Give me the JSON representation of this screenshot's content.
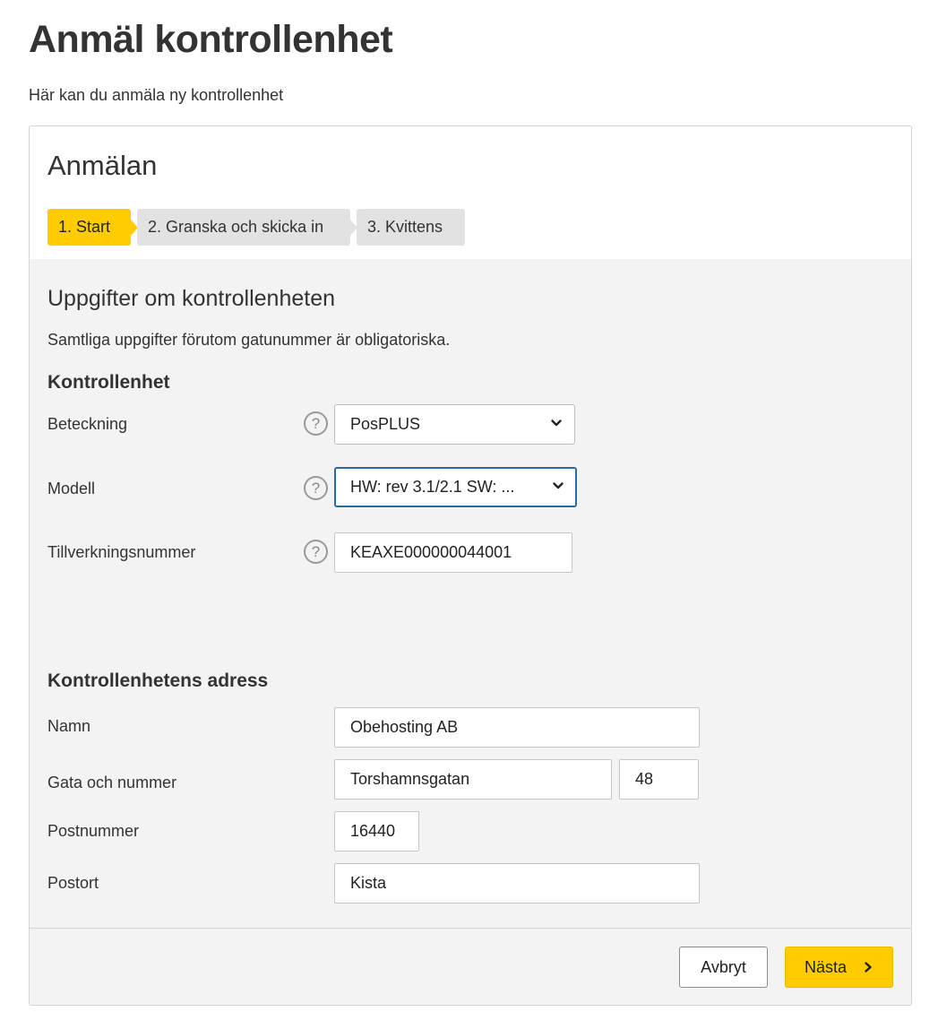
{
  "page": {
    "title": "Anmäl kontrollenhet",
    "subtitle": "Här kan du anmäla ny kontrollenhet"
  },
  "card": {
    "title": "Anmälan",
    "steps": [
      {
        "label": "1. Start",
        "active": true
      },
      {
        "label": "2. Granska och skicka in",
        "active": false
      },
      {
        "label": "3. Kvittens",
        "active": false
      }
    ]
  },
  "section": {
    "title": "Uppgifter om kontrollenheten",
    "note": "Samtliga uppgifter förutom gatunummer är obligatoriska."
  },
  "unit": {
    "heading": "Kontrollenhet",
    "designation": {
      "label": "Beteckning",
      "value": "PosPLUS"
    },
    "model": {
      "label": "Modell",
      "value": "HW: rev 3.1/2.1 SW: ..."
    },
    "serial": {
      "label": "Tillverkningsnummer",
      "value": "KEAXE000000044001"
    },
    "help_symbol": "?"
  },
  "address": {
    "heading": "Kontrollenhetens adress",
    "name": {
      "label": "Namn",
      "value": "Obehosting AB"
    },
    "street": {
      "label": "Gata och nummer",
      "value": "Torshamnsgatan",
      "number": "48"
    },
    "postcode": {
      "label": "Postnummer",
      "value": "16440"
    },
    "city": {
      "label": "Postort",
      "value": "Kista"
    }
  },
  "footer": {
    "cancel_label": "Avbryt",
    "next_label": "Nästa"
  },
  "colors": {
    "accent": "#ffcc00",
    "step_inactive": "#e2e2e2",
    "focus_border": "#2b6aa8",
    "panel_bg": "#f3f3f3"
  },
  "icons": {
    "help": "help-icon",
    "dropdown": "chevron-down-icon",
    "next": "chevron-right-icon"
  }
}
